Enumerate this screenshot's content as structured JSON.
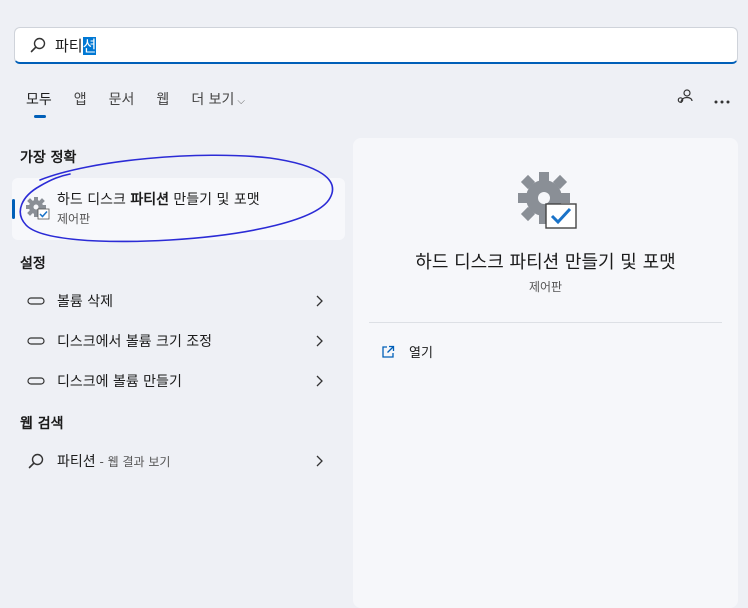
{
  "search": {
    "query_prefix": "파티",
    "query_selected": "션"
  },
  "tabs": [
    {
      "label": "모두"
    },
    {
      "label": "앱"
    },
    {
      "label": "문서"
    },
    {
      "label": "웹"
    },
    {
      "label": "더 보기"
    }
  ],
  "sections": {
    "best_match": "가장 정확",
    "settings": "설정",
    "web_search": "웹 검색"
  },
  "best_match": {
    "title_prefix": "하드 디스크 ",
    "title_bold": "파티션",
    "title_suffix": " 만들기 및 포맷",
    "subtitle": "제어판"
  },
  "settings_items": [
    {
      "label": "볼륨 삭제"
    },
    {
      "label": "디스크에서 볼륨 크기 조정"
    },
    {
      "label": "디스크에 볼륨 만들기"
    }
  ],
  "web_item": {
    "query": "파티션",
    "hint": " - 웹 결과 보기"
  },
  "detail": {
    "title": "하드 디스크 파티션 만들기 및 포맷",
    "subtitle": "제어판",
    "open_label": "열기"
  },
  "colors": {
    "accent": "#005fb8",
    "annotation": "#2b2bd6"
  }
}
